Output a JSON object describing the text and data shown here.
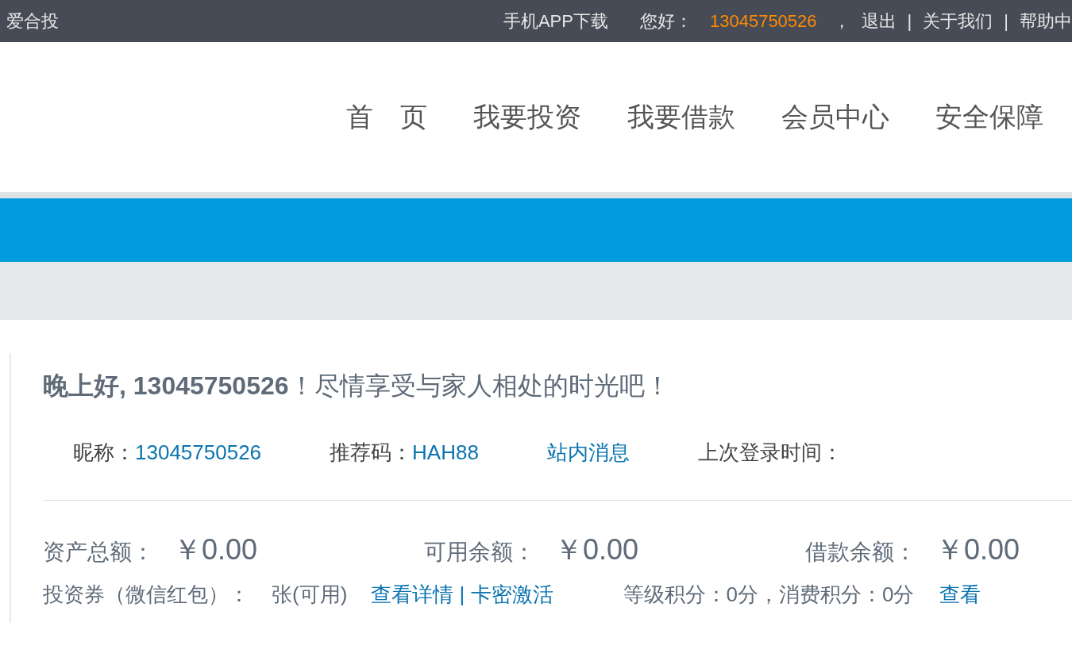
{
  "top_bar": {
    "brand": "爱合投",
    "items": [
      {
        "kind": "link",
        "text": "手机APP下载"
      },
      {
        "kind": "text",
        "text": "您好："
      },
      {
        "kind": "user",
        "text": "13045750526"
      },
      {
        "kind": "text",
        "text": "，"
      },
      {
        "kind": "link",
        "text": "退出"
      },
      {
        "kind": "sep",
        "text": "|"
      },
      {
        "kind": "link",
        "text": "关于我们"
      },
      {
        "kind": "sep",
        "text": "|"
      },
      {
        "kind": "link",
        "text": "帮助中"
      }
    ]
  },
  "nav": [
    {
      "label": "首　页"
    },
    {
      "label": "我要投资"
    },
    {
      "label": "我要借款"
    },
    {
      "label": "会员中心"
    },
    {
      "label": "安全保障"
    }
  ],
  "greeting": "**晚上好, 13045750526**！尽情享受与家人相处的时光吧！",
  "info": [
    {
      "label": "昵称：",
      "value": "13045750526"
    },
    {
      "label": "推荐码：",
      "value": "HAH88"
    },
    {
      "link": "站内消息"
    },
    {
      "label": "上次登录时间："
    }
  ],
  "balances": [
    {
      "label": "资产总额：",
      "value": "￥0.00"
    },
    {
      "label": "可用余额：",
      "value": "￥0.00"
    },
    {
      "label": "借款余额：",
      "value": "￥0.00"
    }
  ],
  "coupons": {
    "label": "投资券（微信红包）：",
    "count": "张(可用)",
    "link": "查看详情 | 卡密激活",
    "points": "等级积分：0分，消费积分：0分",
    "points_link": "查看"
  }
}
